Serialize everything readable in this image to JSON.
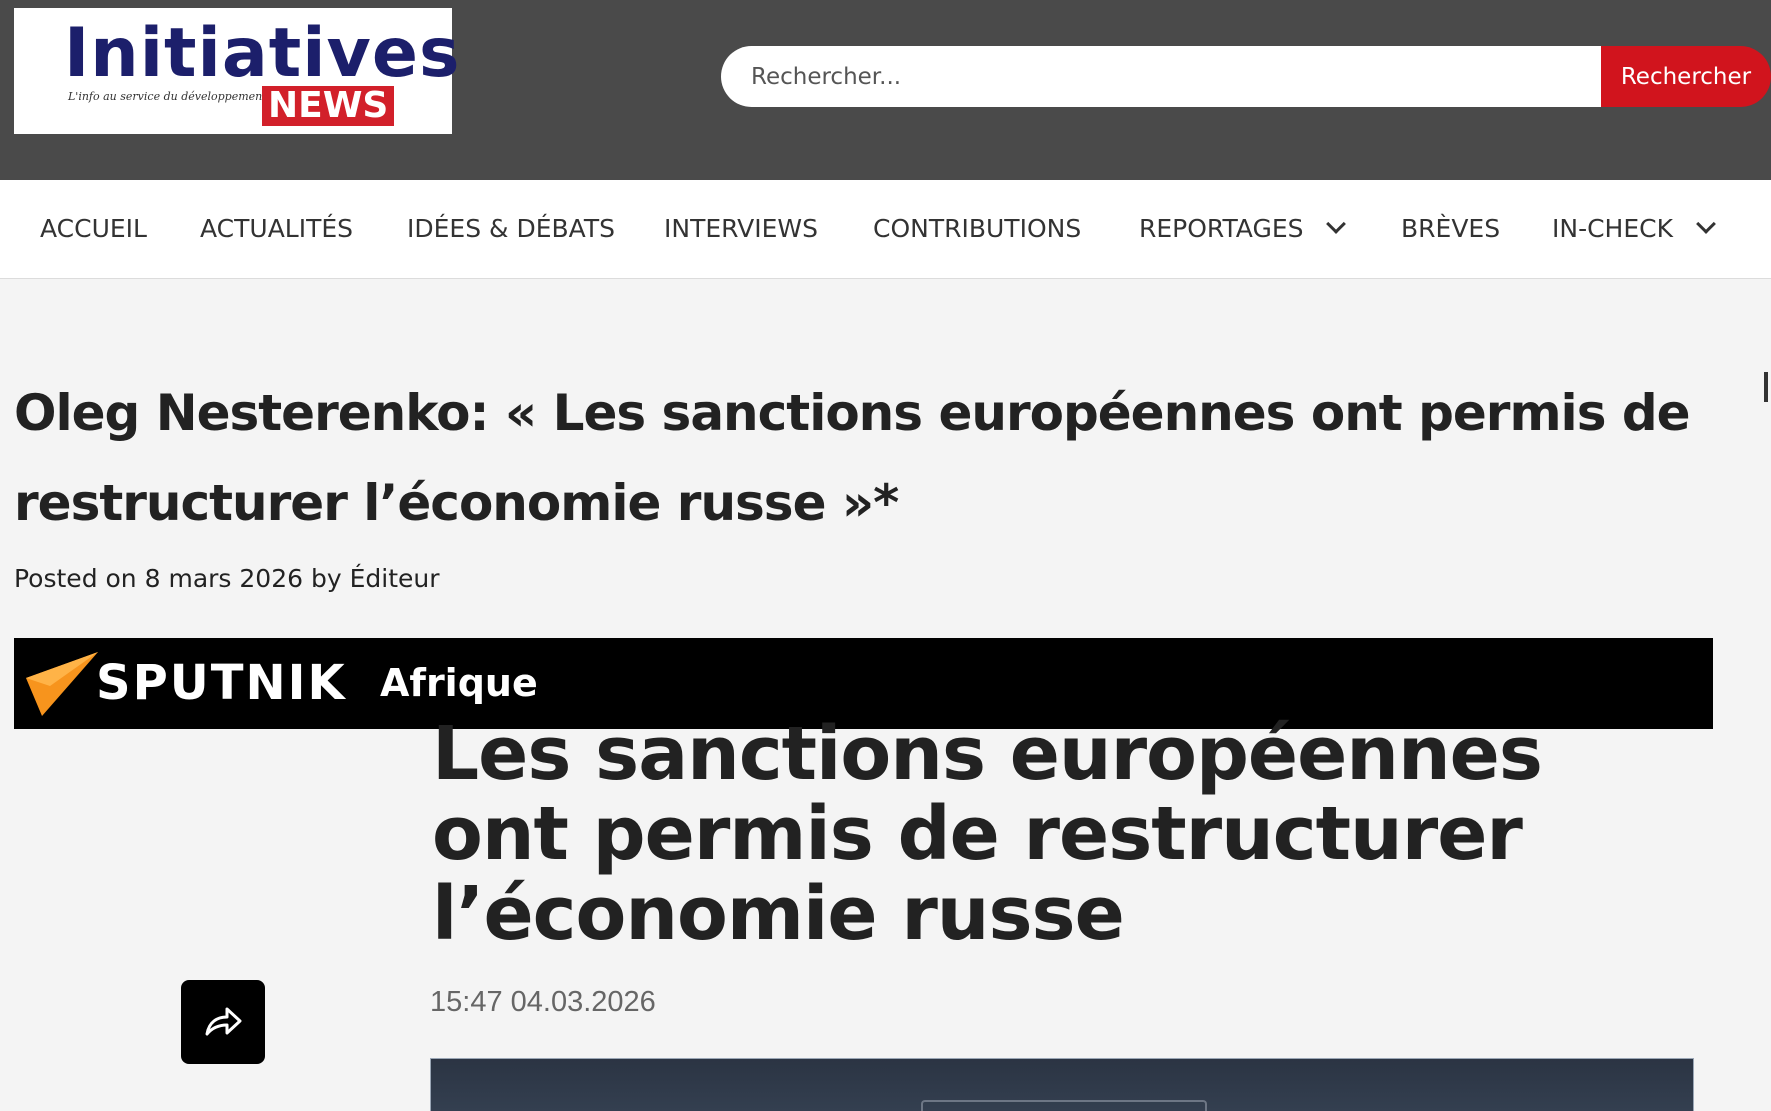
{
  "header": {
    "logo": {
      "name": "Initiatives",
      "badge": "NEWS",
      "tagline": "L'info au service du développement"
    },
    "search": {
      "placeholder": "Rechercher...",
      "button_label": "Rechercher"
    }
  },
  "nav": {
    "items": [
      {
        "label": "ACCUEIL"
      },
      {
        "label": "ACTUALITÉS"
      },
      {
        "label": "IDÉES & DÉBATS"
      },
      {
        "label": "INTERVIEWS"
      },
      {
        "label": "CONTRIBUTIONS"
      },
      {
        "label": "REPORTAGES",
        "has_dropdown": true
      },
      {
        "label": "BRÈVES"
      },
      {
        "label": "IN-CHECK",
        "has_dropdown": true
      }
    ]
  },
  "article": {
    "title": "Oleg Nesterenko: « Les sanctions européennes ont permis de restructurer l’économie russe »*",
    "meta": {
      "posted_prefix": "Posted on",
      "date": "8 mars 2026",
      "by_prefix": "by",
      "author": "Éditeur"
    }
  },
  "embed": {
    "brand": "SPUTNIK",
    "region": "Afrique",
    "headline": "Les sanctions européennes ont permis de restructurer l’économie russe",
    "timestamp": "15:47 04.03.2026"
  },
  "colors": {
    "header_bg": "#4a4a4a",
    "accent_red": "#d1141d",
    "logo_blue": "#1c1f6b",
    "sputnik_orange": "#f7941d"
  }
}
